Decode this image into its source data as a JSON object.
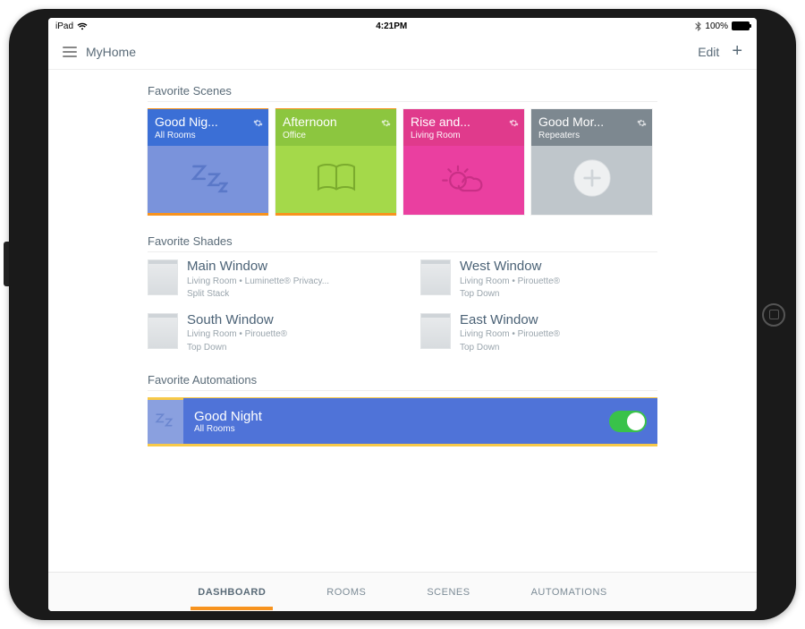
{
  "status": {
    "device": "iPad",
    "time": "4:21PM",
    "battery_pct": "100%"
  },
  "header": {
    "title": "MyHome",
    "edit": "Edit"
  },
  "sections": {
    "scenes": "Favorite Scenes",
    "shades": "Favorite Shades",
    "automations": "Favorite Automations"
  },
  "scenes": [
    {
      "title": "Good Nig...",
      "subtitle": "All Rooms",
      "icon": "sleep-icon",
      "colors": {
        "head": "#3b6fd6",
        "body": "#7a93db"
      }
    },
    {
      "title": "Afternoon",
      "subtitle": "Office",
      "icon": "book-icon",
      "colors": {
        "head": "#8cc63f",
        "body": "#a4d94a"
      }
    },
    {
      "title": "Rise and...",
      "subtitle": "Living Room",
      "icon": "sunrise-icon",
      "colors": {
        "head": "#e03a8c",
        "body": "#ea3fa0"
      }
    },
    {
      "title": "Good Mor...",
      "subtitle": "Repeaters",
      "icon": "disc-icon",
      "colors": {
        "head": "#7d8890",
        "body": "#bfc6cb"
      }
    }
  ],
  "shades": [
    {
      "name": "Main Window",
      "line1": "Living Room • Luminette® Privacy...",
      "line2": "Split Stack"
    },
    {
      "name": "West Window",
      "line1": "Living Room • Pirouette®",
      "line2": "Top Down"
    },
    {
      "name": "South Window",
      "line1": "Living Room • Pirouette®",
      "line2": "Top Down"
    },
    {
      "name": "East Window",
      "line1": "Living Room • Pirouette®",
      "line2": "Top Down"
    }
  ],
  "automations": [
    {
      "title": "Good Night",
      "subtitle": "All Rooms",
      "enabled": true
    }
  ],
  "tabs": {
    "dashboard": "DASHBOARD",
    "rooms": "ROOMS",
    "scenes": "SCENES",
    "automations": "AUTOMATIONS"
  }
}
